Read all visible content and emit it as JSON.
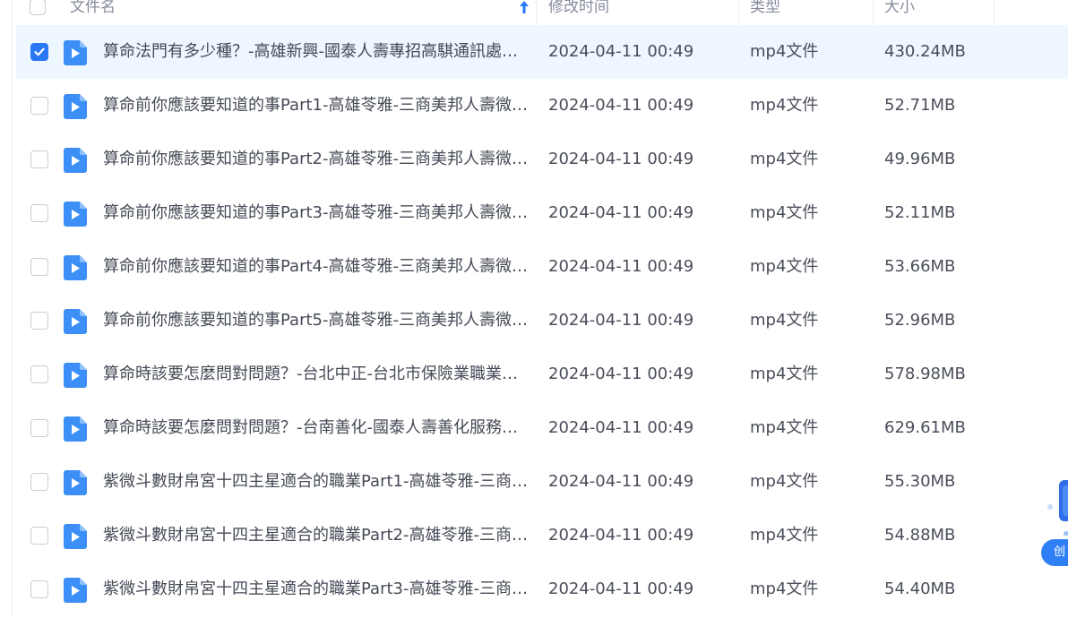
{
  "table": {
    "headers": {
      "name": "文件名",
      "mtime": "修改时间",
      "type": "类型",
      "size": "大小"
    },
    "rows": [
      {
        "name": "算命法門有多少種？-高雄新興-國泰人壽專招高騏通訊處…",
        "mtime": "2024-04-11 00:49",
        "type": "mp4文件",
        "size": "430.24MB",
        "selected": true
      },
      {
        "name": "算命前你應該要知道的事Part1-高雄苓雅-三商美邦人壽微…",
        "mtime": "2024-04-11 00:49",
        "type": "mp4文件",
        "size": "52.71MB",
        "selected": false
      },
      {
        "name": "算命前你應該要知道的事Part2-高雄苓雅-三商美邦人壽微…",
        "mtime": "2024-04-11 00:49",
        "type": "mp4文件",
        "size": "49.96MB",
        "selected": false
      },
      {
        "name": "算命前你應該要知道的事Part3-高雄苓雅-三商美邦人壽微…",
        "mtime": "2024-04-11 00:49",
        "type": "mp4文件",
        "size": "52.11MB",
        "selected": false
      },
      {
        "name": "算命前你應該要知道的事Part4-高雄苓雅-三商美邦人壽微…",
        "mtime": "2024-04-11 00:49",
        "type": "mp4文件",
        "size": "53.66MB",
        "selected": false
      },
      {
        "name": "算命前你應該要知道的事Part5-高雄苓雅-三商美邦人壽微…",
        "mtime": "2024-04-11 00:49",
        "type": "mp4文件",
        "size": "52.96MB",
        "selected": false
      },
      {
        "name": "算命時該要怎麼問對問題？-台北中正-台北市保險業職業…",
        "mtime": "2024-04-11 00:49",
        "type": "mp4文件",
        "size": "578.98MB",
        "selected": false
      },
      {
        "name": "算命時該要怎麼問對問題？-台南善化-國泰人壽善化服務…",
        "mtime": "2024-04-11 00:49",
        "type": "mp4文件",
        "size": "629.61MB",
        "selected": false
      },
      {
        "name": "紫微斗數財帛宮十四主星適合的職業Part1-高雄苓雅-三商…",
        "mtime": "2024-04-11 00:49",
        "type": "mp4文件",
        "size": "55.30MB",
        "selected": false
      },
      {
        "name": "紫微斗數財帛宮十四主星適合的職業Part2-高雄苓雅-三商…",
        "mtime": "2024-04-11 00:49",
        "type": "mp4文件",
        "size": "54.88MB",
        "selected": false
      },
      {
        "name": "紫微斗數財帛宮十四主星適合的職業Part3-高雄苓雅-三商…",
        "mtime": "2024-04-11 00:49",
        "type": "mp4文件",
        "size": "54.40MB",
        "selected": false
      }
    ]
  },
  "float_widget": {
    "label": "创",
    "icon": "assistant-icon"
  },
  "colors": {
    "accent": "#2a77f6",
    "selected_row": "#eef6ff",
    "video_icon": "#3b8ff7"
  }
}
